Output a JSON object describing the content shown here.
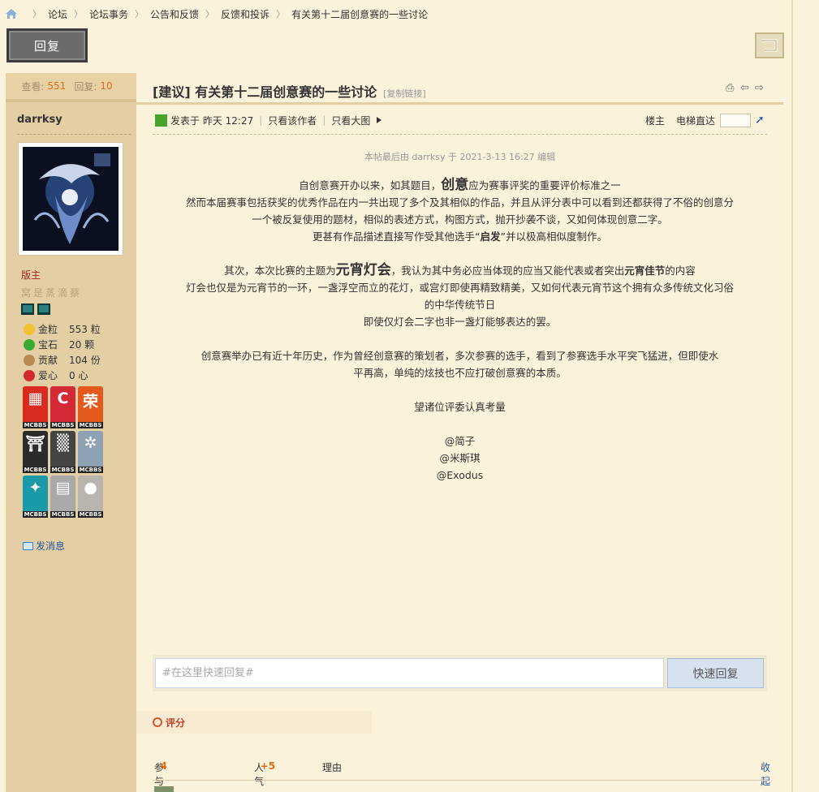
{
  "breadcrumb": [
    "论坛",
    "论坛事务",
    "公告和反馈",
    "反馈和投诉",
    "有关第十二届创意赛的一些讨论"
  ],
  "reply_button": "回复",
  "sidebar": {
    "views_label": "查看:",
    "views": "551",
    "replies_label": "回复:",
    "replies": "10",
    "author": "darrksy",
    "rank": "版主",
    "rank_sub": "窝是蒸滴蔡",
    "stats": [
      {
        "label": "金粒",
        "value": "553 粒",
        "icon": "gold-nugget-icon"
      },
      {
        "label": "宝石",
        "value": "20 颗",
        "icon": "emerald-icon"
      },
      {
        "label": "贡献",
        "value": "104 份",
        "icon": "cookie-icon"
      },
      {
        "label": "爱心",
        "value": "0 心",
        "icon": "apple-icon"
      }
    ],
    "badges": [
      {
        "glyph": "▦",
        "tag": "MCBBS",
        "color": "#d92b1f"
      },
      {
        "glyph": "C",
        "tag": "MCBBS",
        "color": "#d42a35"
      },
      {
        "glyph": "荣",
        "tag": "MCBBS",
        "color": "#e35a1c"
      },
      {
        "glyph": "⛩",
        "tag": "MCBBS",
        "color": "#2b2b2b"
      },
      {
        "glyph": "▒",
        "tag": "MCBBS",
        "color": "#444444"
      },
      {
        "glyph": "✲",
        "tag": "MCBBS",
        "color": "#8fa2b4"
      },
      {
        "glyph": "✦",
        "tag": "MCBBS",
        "color": "#1a9aa8"
      },
      {
        "glyph": "▤",
        "tag": "MCBBS",
        "color": "#a9a9a9"
      },
      {
        "glyph": "●",
        "tag": "MCBBS",
        "color": "#b9b4ad"
      }
    ],
    "send_message": "发消息"
  },
  "post": {
    "prefix": "[建议]",
    "title": "有关第十二届创意赛的一些讨论",
    "copy_link": "[复制链接]",
    "posted_label": "发表于",
    "posted_time": "昨天 12:27",
    "only_author": "只看该作者",
    "big_image": "只看大图",
    "floor": "楼主",
    "jump_label": "电梯直达",
    "edit_note": "本帖最后由 darrksy 于 2021-3-13 16:27 编辑",
    "p1_a": "自创意赛开办以来，如其题目，",
    "p1_big": "创意",
    "p1_b": "应为赛事评奖的重要评价标准之一",
    "p2": "然而本届赛事包括获奖的优秀作品在内一共出现了多个及其相似的作品，并且从评分表中可以看到还都获得了不俗的创意分",
    "p3": "一个被反复使用的题材，相似的表述方式，构图方式，抛开抄袭不谈，又如何体现创意二字。",
    "p4_a": "更甚有作品描述直接写作受其他选手“",
    "p4_b": "启发",
    "p4_c": "”并以极高相似度制作。",
    "p5_a": "其次，本次比赛的主题为",
    "p5_big": "元宵灯会",
    "p5_b": "，我认为其中务必应当体现的应当又能代表或者突出",
    "p5_bold": "元宵佳节",
    "p5_c": "的内容",
    "p6": "灯会也仅是为元宵节的一环，一盏浮空而立的花灯，或宫灯即使再精致精美，又如何代表元宵节这个拥有众多传统文化习俗",
    "p7": "的中华传统节日",
    "p8": "即使仅灯会二字也非一盏灯能够表达的罢。",
    "p9": "创意赛举办已有近十年历史，作为曾经创意赛的策划者，多次参赛的选手，看到了参赛选手水平突飞猛进，但即使水",
    "p10": "平再高，单纯的炫技也不应打破创意赛的本质。",
    "p11": "望诸位评委认真考量",
    "sig1": "@简子",
    "sig2": "@米斯琪",
    "sig3": "@Exodus"
  },
  "quick_reply": {
    "placeholder": "#在这里快速回复#",
    "button": "快速回复"
  },
  "rating": {
    "header": "评分",
    "participants_label": "参与人数",
    "participants": "4",
    "popularity_label": "人气",
    "popularity": "+5",
    "reason_label": "理由",
    "collapse": "收起"
  }
}
